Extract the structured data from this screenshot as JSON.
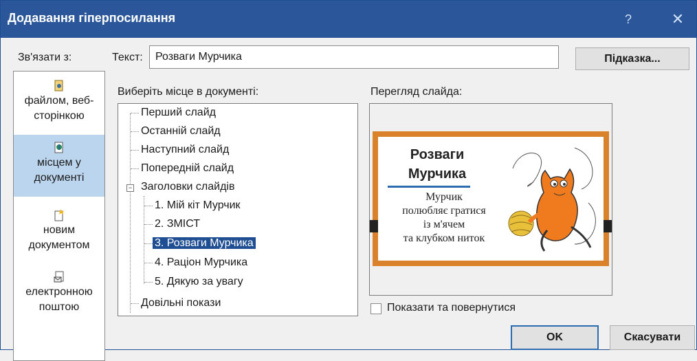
{
  "window": {
    "title": "Додавання гіперпосилання",
    "help_glyph": "?",
    "close_glyph": "✕"
  },
  "link_to": {
    "label": "Зв'язати з:",
    "items": [
      {
        "label": "файлом, веб-сторінкою",
        "icon": "existing-file-icon",
        "selected": false
      },
      {
        "label": "місцем у документі",
        "icon": "place-in-document-icon",
        "selected": true
      },
      {
        "label": "новим документом",
        "icon": "new-document-icon",
        "selected": false
      },
      {
        "label": "електронною поштою",
        "icon": "email-icon",
        "selected": false
      }
    ]
  },
  "text_field": {
    "label": "Текст:",
    "value": "Розваги Мурчика"
  },
  "hint_button": "Підказка...",
  "tree": {
    "label": "Виберіть місце в документі:",
    "nodes": [
      {
        "label": "Перший слайд",
        "level": 0
      },
      {
        "label": "Останній слайд",
        "level": 0
      },
      {
        "label": "Наступний слайд",
        "level": 0
      },
      {
        "label": "Попередній слайд",
        "level": 0
      },
      {
        "label": "Заголовки слайдів",
        "level": 0,
        "expanded": true
      },
      {
        "label": "1. Мій кіт Мурчик",
        "level": 1
      },
      {
        "label": "2. ЗМІСТ",
        "level": 1
      },
      {
        "label": "3. Розваги Мурчика",
        "level": 1,
        "selected": true
      },
      {
        "label": "4. Раціон Мурчика",
        "level": 1
      },
      {
        "label": "5. Дякую за увагу",
        "level": 1
      },
      {
        "label": "Довільні покази",
        "level": 0
      }
    ]
  },
  "preview": {
    "label": "Перегляд слайда:",
    "slide_title_line1": "Розваги",
    "slide_title_line2": "Мурчика",
    "slide_body": [
      "Мурчик",
      "полюбляє гратися",
      "із м'ячем",
      "та клубком ниток"
    ],
    "frame_color": "#d9822b",
    "accent_color": "#2b6cb0"
  },
  "show_and_return": {
    "label": "Показати та повернутися",
    "checked": false
  },
  "buttons": {
    "ok": "OK",
    "cancel": "Скасувати"
  },
  "colors": {
    "titlebar": "#2b579a",
    "selection": "#1f4e93",
    "link_selected": "#bcd5ee"
  }
}
